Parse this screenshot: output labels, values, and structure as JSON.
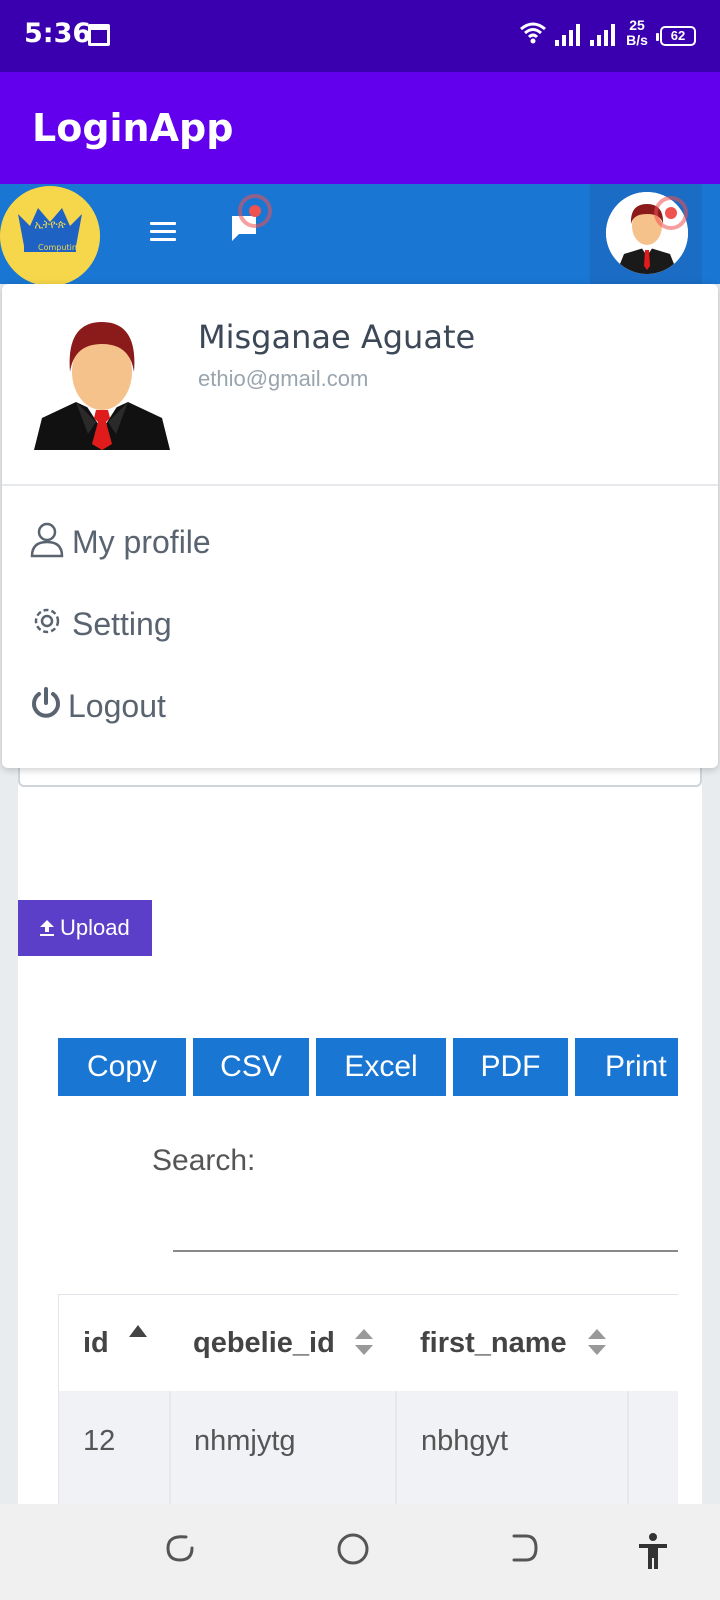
{
  "status_bar": {
    "time": "5:36",
    "net_speed_value": "25",
    "net_speed_unit": "B/s",
    "battery": "62"
  },
  "app_bar": {
    "title": "LoginApp"
  },
  "navbar": {
    "logo_alt": "ኢትዮጵ Computing"
  },
  "dropdown": {
    "user_name": "Misganae Aguate",
    "user_email": "ethio@gmail.com",
    "items": [
      {
        "label": "My profile",
        "icon": "person-icon"
      },
      {
        "label": "Setting",
        "icon": "gear-icon"
      },
      {
        "label": "Logout",
        "icon": "power-icon"
      }
    ]
  },
  "page": {
    "upload_label": "Upload",
    "export_buttons": [
      "Copy",
      "CSV",
      "Excel",
      "PDF",
      "Print"
    ],
    "search_label": "Search:",
    "table": {
      "columns": [
        "id",
        "qebelie_id",
        "first_name"
      ],
      "rows": [
        [
          "12",
          "nhmjytg",
          "nbhgyt"
        ]
      ]
    }
  },
  "colors": {
    "status_bar": "#3a00b0",
    "app_bar": "#6200ee",
    "navbar": "#1976d2",
    "upload_button": "#5b3fc8",
    "export_button": "#1976d2"
  }
}
